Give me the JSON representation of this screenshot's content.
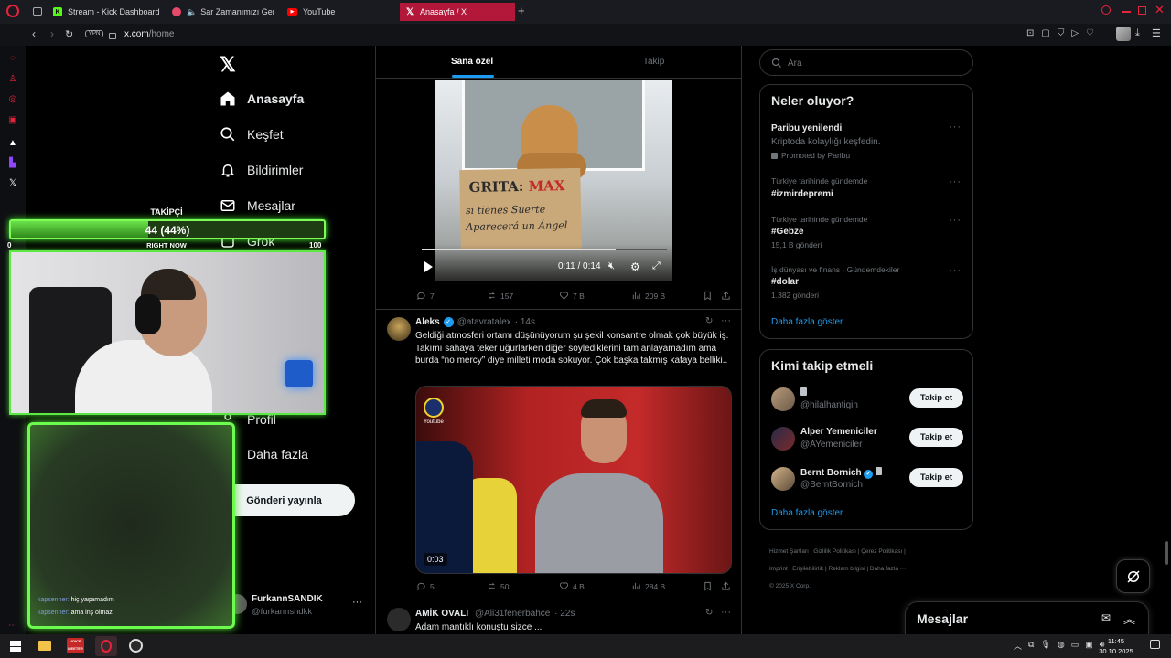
{
  "browser": {
    "tabs": [
      {
        "label": "Stream - Kick Dashboard",
        "icon": "kick-icon",
        "color": "#53fc18"
      },
      {
        "label": "Sar Zamanımızı Geriye",
        "icon": "speaker-icon",
        "color": "#e64a6a"
      },
      {
        "label": "YouTube",
        "icon": "youtube-icon",
        "color": "#ff0000"
      },
      {
        "label": "Anasayfa / X",
        "icon": "x-icon",
        "color": "#ffffff"
      }
    ],
    "url_host": "x.com",
    "url_path": "/home",
    "vpn": "VPN"
  },
  "nav": {
    "home": "Anasayfa",
    "explore": "Keşfet",
    "notifications": "Bildirimler",
    "messages": "Mesajlar",
    "grok": "Grok",
    "profile": "Profil",
    "more": "Daha fazla",
    "post_button": "Gönderi yayınla",
    "account_name": "FurkannSANDIK",
    "account_handle": "@furkannsndkk"
  },
  "overlay": {
    "goal_label": "TAKİPÇİ",
    "goal_value": "44 (44%)",
    "goal_progress": 0.44,
    "goal_min": "0",
    "goal_max": "100",
    "goal_caption": "RIGHT NOW",
    "chat": [
      {
        "user": "kapsenner:",
        "text": "hiç yaşamadım"
      },
      {
        "user": "kapsenner:",
        "text": "ama inş olmaz"
      }
    ]
  },
  "feed": {
    "tab_for_you": "Sana özel",
    "tab_following": "Takip",
    "video1": {
      "sign_line1a": "GRITA:",
      "sign_line1b": "MAX",
      "sign_line2": "si tienes Suerte",
      "sign_line3": "Aparecerá un Ángel",
      "time": "0:11 / 0:14",
      "progress": 0.79
    },
    "post1_actions": {
      "replies": "7",
      "reposts": "157",
      "likes": "7 B",
      "views": "209 B"
    },
    "post2": {
      "name": "Aleks",
      "handle": "@atavratalex",
      "time": "· 14s",
      "text": "Geldiği atmosferi ortamı düşünüyorum şu şekil konsantre olmak çok büyük iş. Takımı sahaya teker uğurlarken diğer söylediklerini tam anlayamadım ama burda “no mercy” diye milleti moda sokuyor. Çok başka takmış kafaya belliki..",
      "video_time": "0:03",
      "video_brand": "Youtube",
      "actions": {
        "replies": "5",
        "reposts": "50",
        "likes": "4 B",
        "views": "284 B"
      }
    },
    "post3": {
      "name": "AMİK OVALI",
      "handle": "@Ali31fenerbahce",
      "time": "· 22s",
      "text": "Adam mantıklı konuştu sizce ..."
    }
  },
  "right": {
    "search_placeholder": "Ara",
    "trends_title": "Neler oluyor?",
    "trends": [
      {
        "context": "",
        "name": "Paribu yenilendi",
        "sub": "Kriptoda kolaylığı keşfedin.",
        "meta": "Promoted by Paribu"
      },
      {
        "context": "Türkiye tarihinde gündemde",
        "name": "#izmirdepremi",
        "meta": ""
      },
      {
        "context": "Türkiye tarihinde gündemde",
        "name": "#Gebze",
        "meta": "15,1 B gönderi"
      },
      {
        "context": "İş dünyası ve finans · Gündemdekiler",
        "name": "#dolar",
        "meta": "1.382 gönderi"
      }
    ],
    "show_more": "Daha fazla göster",
    "follow_title": "Kimi takip etmeli",
    "follow_button": "Takip et",
    "suggestions": [
      {
        "name": "",
        "handle": "@hilalhantigin"
      },
      {
        "name": "Alper Yemeniciler",
        "handle": "@AYemeniciler"
      },
      {
        "name": "Bernt Bornich",
        "handle": "@BerntBornich"
      }
    ],
    "footer": [
      "Hizmet Şartları",
      "Gizlilik Politikası",
      "Çerez Politikası",
      "Imprint",
      "Erişilebilirlik",
      "Reklam bilgisi",
      "Daha fazla ···"
    ],
    "copyright": "© 2025 X Corp.",
    "messages_label": "Mesajlar"
  },
  "taskbar": {
    "time": "11:45",
    "date": "30.10.2025",
    "voice_label": "VOICE MEETER"
  }
}
